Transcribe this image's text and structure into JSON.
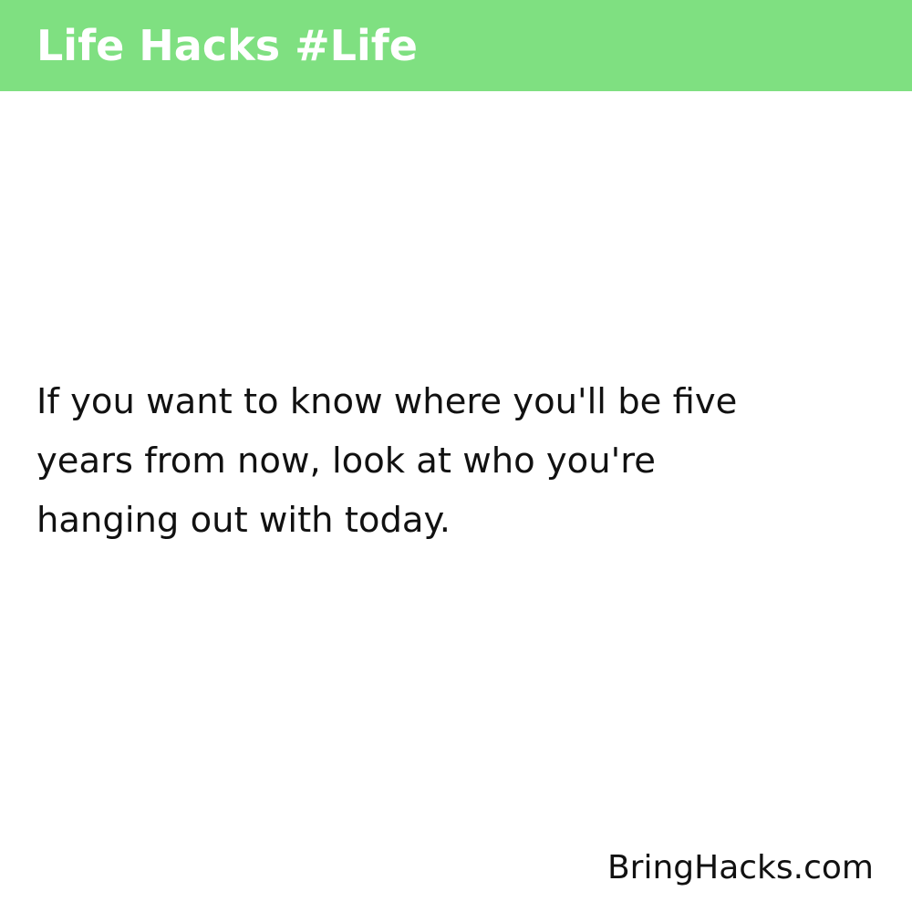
{
  "header": {
    "title": "Life Hacks #Life",
    "background_color": "#7fe081",
    "text_color": "#ffffff"
  },
  "main": {
    "quote_lines": [
      "If you want to know where you'll be five",
      "years from now, look at who you're",
      "hanging out with today."
    ]
  },
  "footer": {
    "site": "BringHacks.com"
  }
}
